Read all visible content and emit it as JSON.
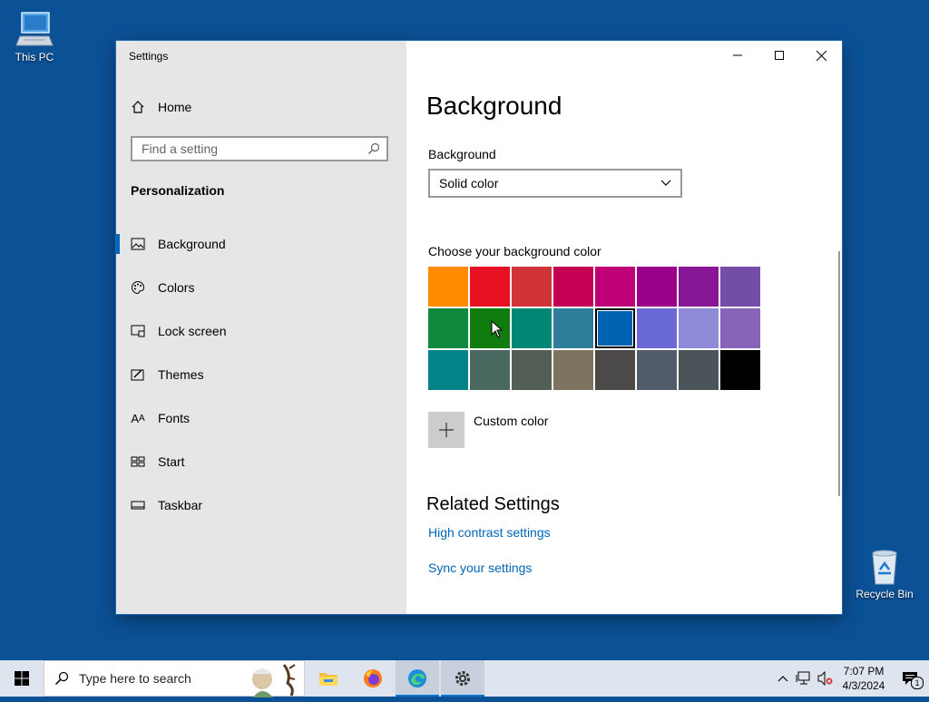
{
  "desktop": {
    "icons": [
      {
        "label": "This PC"
      },
      {
        "label": "Recycle Bin"
      }
    ]
  },
  "window": {
    "title": "Settings",
    "controls": {
      "minimize": "minimize-icon",
      "maximize": "maximize-icon",
      "close": "close-icon"
    }
  },
  "sidebar": {
    "home": "Home",
    "search_placeholder": "Find a setting",
    "section": "Personalization",
    "items": [
      {
        "label": "Background",
        "icon": "picture-icon",
        "active": true
      },
      {
        "label": "Colors",
        "icon": "palette-icon"
      },
      {
        "label": "Lock screen",
        "icon": "lock-screen-icon"
      },
      {
        "label": "Themes",
        "icon": "themes-icon"
      },
      {
        "label": "Fonts",
        "icon": "fonts-icon"
      },
      {
        "label": "Start",
        "icon": "start-icon"
      },
      {
        "label": "Taskbar",
        "icon": "taskbar-icon"
      }
    ]
  },
  "main": {
    "title": "Background",
    "background_label": "Background",
    "background_value": "Solid color",
    "choose_label": "Choose your background color",
    "colors": [
      "#ff8c00",
      "#e81123",
      "#d13438",
      "#c30052",
      "#bf0077",
      "#9a0089",
      "#881798",
      "#744da9",
      "#10893e",
      "#107c10",
      "#018574",
      "#2d7d9a",
      "#0063b1",
      "#6b69d6",
      "#8e8cd8",
      "#8764b8",
      "#038387",
      "#486860",
      "#525e54",
      "#7e735f",
      "#4c4a48",
      "#515c6b",
      "#4a5459",
      "#000000"
    ],
    "selected_color_index": 12,
    "custom_color": "Custom color",
    "related_title": "Related Settings",
    "links": [
      "High contrast settings",
      "Sync your settings"
    ]
  },
  "taskbar": {
    "search_placeholder": "Type here to search",
    "apps": [
      "file-explorer-icon",
      "firefox-icon",
      "edge-icon",
      "settings-icon"
    ],
    "time": "7:07 PM",
    "date": "4/3/2024",
    "notification_count": "1"
  }
}
